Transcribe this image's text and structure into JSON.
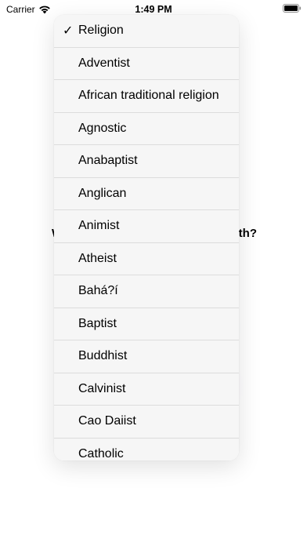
{
  "status_bar": {
    "carrier": "Carrier",
    "time": "1:49 PM",
    "wifi_icon": "wifi-icon",
    "battery_icon": "battery-icon"
  },
  "background": {
    "question_left": "W",
    "question_right": "th?"
  },
  "menu": {
    "check_icon": "✓",
    "items": [
      {
        "label": "Religion",
        "selected": true
      },
      {
        "label": "Adventist",
        "selected": false
      },
      {
        "label": "African traditional religion",
        "selected": false
      },
      {
        "label": "Agnostic",
        "selected": false
      },
      {
        "label": "Anabaptist",
        "selected": false
      },
      {
        "label": "Anglican",
        "selected": false
      },
      {
        "label": "Animist",
        "selected": false
      },
      {
        "label": "Atheist",
        "selected": false
      },
      {
        "label": "Bahá?í",
        "selected": false
      },
      {
        "label": "Baptist",
        "selected": false
      },
      {
        "label": "Buddhist",
        "selected": false
      },
      {
        "label": "Calvinist",
        "selected": false
      },
      {
        "label": "Cao Daiist",
        "selected": false
      },
      {
        "label": "Catholic",
        "selected": false
      }
    ]
  }
}
